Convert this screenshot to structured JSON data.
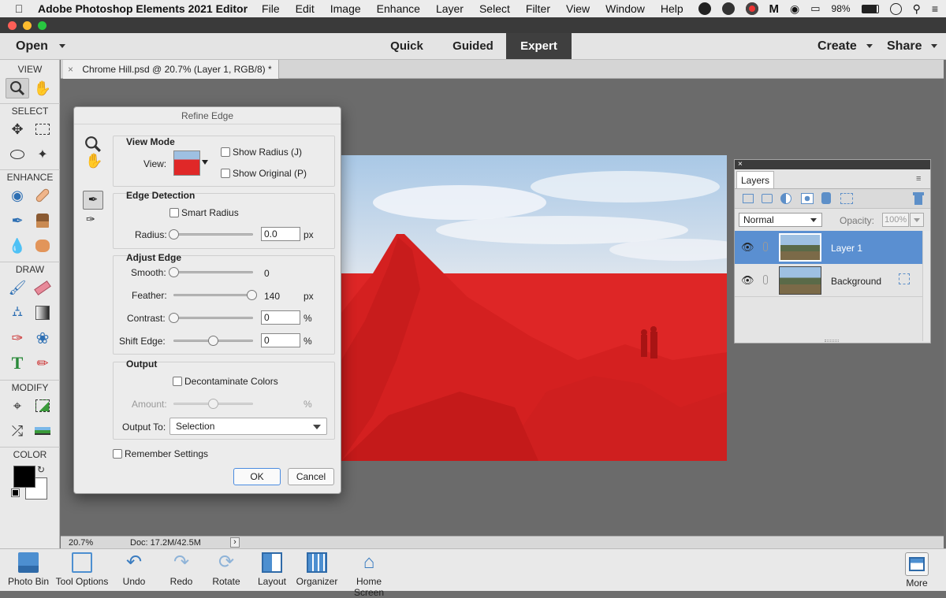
{
  "menubar": {
    "app_name": "Adobe Photoshop Elements 2021 Editor",
    "items": [
      "File",
      "Edit",
      "Image",
      "Enhance",
      "Layer",
      "Select",
      "Filter",
      "View",
      "Window",
      "Help"
    ],
    "battery": "98%"
  },
  "topbar": {
    "open_label": "Open",
    "modes": [
      "Quick",
      "Guided",
      "Expert"
    ],
    "active_mode": "Expert",
    "create_label": "Create",
    "share_label": "Share"
  },
  "toolbox": {
    "sections": [
      "VIEW",
      "SELECT",
      "ENHANCE",
      "DRAW",
      "MODIFY",
      "COLOR"
    ]
  },
  "document": {
    "tab_label": "Chrome Hill.psd @ 20.7% (Layer 1, RGB/8) *",
    "close_glyph": "×"
  },
  "statusbar": {
    "zoom": "20.7%",
    "doc_info": "Doc: 17.2M/42.5M",
    "arrow": "›"
  },
  "bottombar": {
    "buttons": [
      "Photo Bin",
      "Tool Options",
      "Undo",
      "Redo",
      "Rotate",
      "Layout",
      "Organizer",
      "Home Screen",
      "More"
    ]
  },
  "refine_edge": {
    "title": "Refine Edge",
    "view_mode": {
      "title": "View Mode",
      "view_label": "View:",
      "show_radius": "Show Radius (J)",
      "show_original": "Show Original (P)"
    },
    "edge_detection": {
      "title": "Edge Detection",
      "smart_radius": "Smart Radius",
      "radius_label": "Radius:",
      "radius_value": "0.0",
      "radius_unit": "px",
      "radius_level": 0
    },
    "adjust_edge": {
      "title": "Adjust Edge",
      "smooth_label": "Smooth:",
      "smooth_value": "0",
      "smooth_level": 0,
      "feather_label": "Feather:",
      "feather_value": "140",
      "feather_unit": "px",
      "feather_level": 1,
      "contrast_label": "Contrast:",
      "contrast_value": "0",
      "contrast_unit": "%",
      "contrast_level": 0,
      "shift_label": "Shift Edge:",
      "shift_value": "0",
      "shift_unit": "%",
      "shift_level": 0.5
    },
    "output": {
      "title": "Output",
      "decontaminate": "Decontaminate Colors",
      "amount_label": "Amount:",
      "amount_unit": "%",
      "amount_level": 0.5,
      "output_to_label": "Output To:",
      "output_to_value": "Selection"
    },
    "remember": "Remember Settings",
    "ok_label": "OK",
    "cancel_label": "Cancel"
  },
  "layers_panel": {
    "tab_label": "Layers",
    "blend_mode": "Normal",
    "opacity_label": "Opacity:",
    "opacity_value": "100%",
    "layers": [
      {
        "name": "Layer 1",
        "selected": true
      },
      {
        "name": "Background",
        "selected": false
      }
    ]
  },
  "colors": {
    "accent": "#5a8fd1",
    "overlay_red": "#e02828",
    "foreground": "#000000",
    "background": "#ffffff"
  }
}
